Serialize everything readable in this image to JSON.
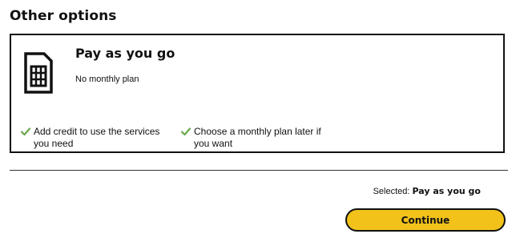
{
  "section": {
    "title": "Other options"
  },
  "option_card": {
    "icon": "sim-card-icon",
    "name": "Pay as you go",
    "description": "No monthly plan",
    "features": [
      {
        "icon": "check-icon",
        "text": "Add credit to use the services you need"
      },
      {
        "icon": "check-icon",
        "text": "Choose a monthly plan later if you want"
      }
    ]
  },
  "summary": {
    "selected_label": "Selected:",
    "selected_value": "Pay as you go"
  },
  "actions": {
    "continue_label": "Continue"
  },
  "colors": {
    "accent": "#f2c21b",
    "check": "#6aa84f",
    "border": "#111111"
  }
}
